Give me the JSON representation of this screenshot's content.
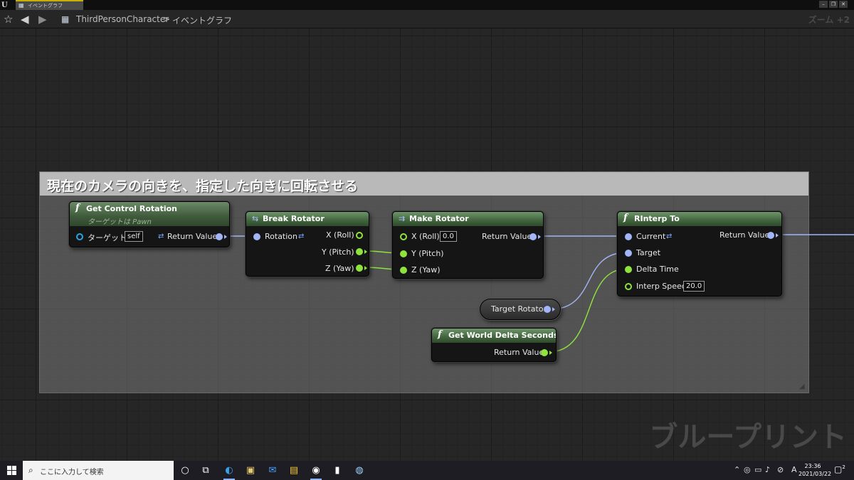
{
  "window": {
    "tab_label": "イベントグラフ",
    "app_logo": "U"
  },
  "toolbar": {
    "breadcrumb_root": "ThirdPersonCharacter",
    "breadcrumb_sep": ">",
    "breadcrumb_current": "イベントグラフ",
    "zoom": "ズーム +2"
  },
  "comment": {
    "title": "現在のカメラの向きを、指定した向きに回転させる"
  },
  "nodes": {
    "get_control_rotation": {
      "title": "Get Control Rotation",
      "subtitle": "ターゲットは Pawn",
      "target_label": "ターゲット",
      "target_value": "self",
      "return_label": "Return Value"
    },
    "break_rotator": {
      "title": "Break Rotator",
      "input_label": "Rotation",
      "out_x": "X (Roll)",
      "out_y": "Y (Pitch)",
      "out_z": "Z (Yaw)"
    },
    "make_rotator": {
      "title": "Make Rotator",
      "in_x": "X (Roll)",
      "in_x_value": "0.0",
      "in_y": "Y (Pitch)",
      "in_z": "Z (Yaw)",
      "return_label": "Return Value"
    },
    "rinterp_to": {
      "title": "RInterp To",
      "current": "Current",
      "target": "Target",
      "delta_time": "Delta Time",
      "interp_speed": "Interp Speed",
      "interp_speed_value": "20.0",
      "return_label": "Return Value"
    },
    "target_rotator": {
      "label": "Target Rotator"
    },
    "get_world_delta_seconds": {
      "title": "Get World Delta Seconds",
      "return_label": "Return Value"
    }
  },
  "watermark": "ブループリント",
  "taskbar": {
    "search_placeholder": "ここに入力して検索",
    "time": "23:36",
    "date": "2021/03/22",
    "ime": "A",
    "notification_count": "2"
  },
  "colors": {
    "rotator_pin": "#a2b5f7",
    "float_pin": "#8fe33e",
    "object_pin": "#2aa4e6",
    "node_header": "#41643d"
  }
}
